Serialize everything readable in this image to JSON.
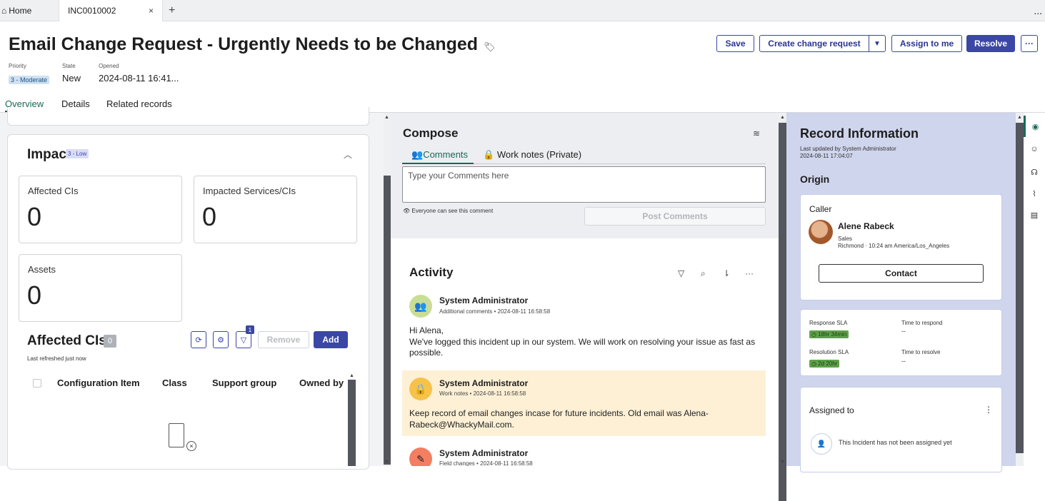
{
  "tabs": {
    "home": "Home",
    "active": "INC0010002",
    "close": "×",
    "plus": "+",
    "more": "..."
  },
  "record": {
    "title": "Email Change Request - Urgently Needs to be Changed",
    "meta": {
      "priority_label": "Priority",
      "state_label": "State",
      "opened_label": "Opened",
      "priority_value": "3 - Moderate",
      "state_value": "New",
      "opened_value": "2024-08-11 16:41..."
    }
  },
  "actions": {
    "save": "Save",
    "create_change": "Create change request",
    "assign": "Assign to me",
    "resolve": "Resolve",
    "more": "···"
  },
  "nav_tabs": [
    "Overview",
    "Details",
    "Related records"
  ],
  "impact": {
    "title": "Impact",
    "badge": "3 - Low",
    "cards": [
      {
        "label": "Affected CIs",
        "value": "0"
      },
      {
        "label": "Impacted Services/CIs",
        "value": "0"
      },
      {
        "label": "Assets",
        "value": "0"
      }
    ]
  },
  "affected_cis": {
    "title": "Affected CIs",
    "count": "0",
    "refreshed": "Last refreshed just now",
    "filter_badge": "1",
    "remove": "Remove",
    "add": "Add",
    "columns": [
      "Configuration Item",
      "Class",
      "Support group",
      "Owned by"
    ]
  },
  "compose": {
    "title": "Compose",
    "tab_comments": "Comments",
    "tab_worknotes": "Work notes (Private)",
    "placeholder": "Type your Comments here",
    "visibility": "Everyone can see this comment",
    "post": "Post Comments"
  },
  "activity": {
    "title": "Activity",
    "entries": [
      {
        "author": "System Administrator",
        "type": "Additional comments",
        "time": "2024-08-11 16:58:58",
        "body": "Hi Alena,\nWe've logged this incident up in our system. We will work on resolving your issue as fast as possible."
      },
      {
        "author": "System Administrator",
        "type": "Work notes",
        "time": "2024-08-11 16:58:58",
        "body": "Keep record of email changes incase for future incidents. Old email was Alena-Rabeck@WhackyMail.com."
      },
      {
        "author": "System Administrator",
        "type": "Field changes",
        "time": "2024-08-11 16:58:58",
        "body": ""
      }
    ]
  },
  "record_info": {
    "title": "Record Information",
    "updated_by": "Last updated by System Administrator",
    "updated_at": "2024-08-11 17:04:07",
    "origin": "Origin",
    "caller_label": "Caller",
    "caller_name": "Alene Rabeck",
    "caller_dept": "Sales",
    "caller_loc": "Richmond · 10:24 am America/Los_Angeles",
    "contact": "Contact",
    "response_sla_label": "Response SLA",
    "response_sla_value": "18hr 34min",
    "time_to_respond_label": "Time to respond",
    "time_to_respond_value": "--",
    "resolution_sla_label": "Resolution SLA",
    "resolution_sla_value": "2d 20hr",
    "time_to_resolve_label": "Time to resolve",
    "time_to_resolve_value": "--",
    "assigned_label": "Assigned to",
    "assigned_text": "This Incident has not been assigned yet"
  },
  "colors": {
    "primary": "#3b47a5",
    "accent_green": "#1a6a56",
    "panel_bg": "#cfd5ec",
    "worknote_bg": "#fdf0d5"
  }
}
